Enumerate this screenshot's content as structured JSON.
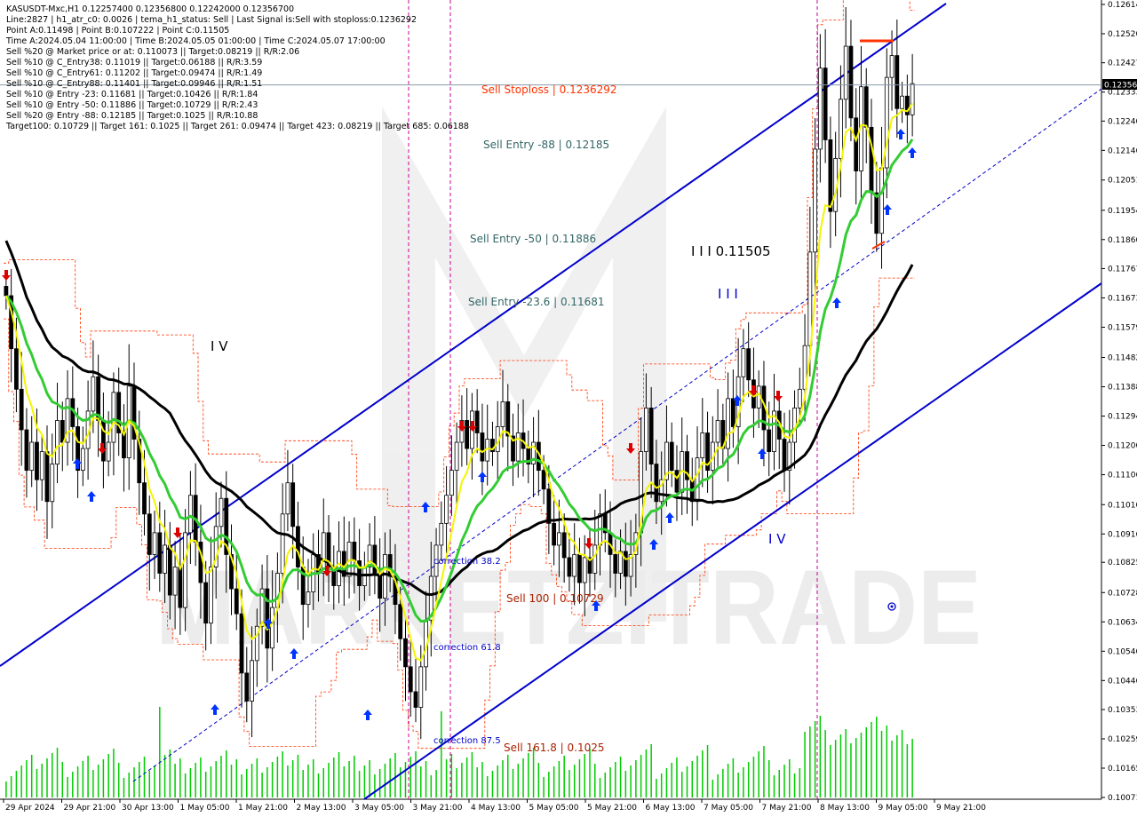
{
  "header": {
    "lines": [
      "KASUSDT-Mxc,H1  0.12257400 0.12356800 0.12242000 0.12356700",
      "Line:2827  |  h1_atr_c0: 0.0026  |  tema_h1_status: Sell  |  Last Signal is:Sell with stoploss:0.1236292",
      "Point A:0.11498  |  Point B:0.107222  |  Point C:0.11505",
      "Time A:2024.05.04 11:00:00  |  Time B:2024.05.05 01:00:00  |  Time C:2024.05.07 17:00:00",
      "Sell %20 @ Market price or at: 0.110073  ||  Target:0.08219  ||  R/R:2.06",
      "Sell %10 @ C_Entry38: 0.11019  ||  Target:0.06188  ||  R/R:3.59",
      "Sell %10 @ C_Entry61: 0.11202  ||  Target:0.09474  ||  R/R:1.49",
      "Sell %10 @ C_Entry88: 0.11401  ||  Target:0.09946  ||  R/R:1.51",
      "Sell %10 @ Entry -23: 0.11681  ||  Target:0.10426  ||  R/R:1.84",
      "Sell %10 @ Entry -50: 0.11886  ||  Target:0.10729  ||  R/R:2.43",
      "Sell %20 @ Entry -88: 0.12185  ||  Target:0.1025  ||  R/R:10.88",
      "Target100: 0.10729  ||  Target 161: 0.1025  ||  Target 261: 0.09474  ||  Target 423: 0.08219  ||  Target 685: 0.06188"
    ]
  },
  "annotations": {
    "sell_stoploss": "Sell Stoploss | 0.1236292",
    "sell_entry_88": "Sell Entry -88 | 0.12185",
    "sell_entry_50": "Sell Entry -50 | 0.11886",
    "sell_entry_23": "Sell Entry -23.6 | 0.11681",
    "wave_c_label": "I I I 0.11505",
    "wave_iii": "I I I",
    "wave_iv_left": "I V",
    "wave_iv_right": "I V",
    "correction_382": "correction 38.2",
    "correction_618": "correction 61.8",
    "correction_875": "correction 87.5",
    "sell_100": "Sell 100 | 0.10729",
    "sell_1618": "Sell 161.8 | 0.1025"
  },
  "current_price_label": "0.12356",
  "watermark": {
    "text": "MARKETZITRADE"
  },
  "colors": {
    "background": "#ffffff",
    "channel": "#0000cc",
    "ma_black": "#000000",
    "ma_green": "#33cc33",
    "ma_yellow": "#f5f500",
    "envelope": "#ff3300",
    "vline": "#cc0099",
    "stoploss": "#ff3300",
    "entry_text": "#336666",
    "price_line": "#8899aa",
    "sell_text": "#aa2200",
    "buy_arrow": "#0033ff",
    "sell_arrow": "#dd0000",
    "volume": "#00cc00"
  },
  "chart_data": {
    "type": "candlestick",
    "symbol": "KASUSDT-Mxc",
    "timeframe": "H1",
    "ohlc_last": {
      "open": 0.122574,
      "high": 0.123568,
      "low": 0.12242,
      "close": 0.123567
    },
    "ylim": [
      0.10071,
      0.12614
    ],
    "y_ticks": [
      0.12614,
      0.1252,
      0.12427,
      0.12333,
      0.1224,
      0.12146,
      0.12051,
      0.11954,
      0.1186,
      0.11767,
      0.11673,
      0.11579,
      0.11482,
      0.11388,
      0.11294,
      0.112,
      0.11106,
      0.1101,
      0.10916,
      0.10825,
      0.10728,
      0.10634,
      0.1054,
      0.10446,
      0.10353,
      0.10259,
      0.10165,
      0.10071
    ],
    "x_labels": [
      "29 Apr 2024",
      "29 Apr 21:00",
      "30 Apr 13:00",
      "1 May 05:00",
      "1 May 21:00",
      "2 May 13:00",
      "3 May 05:00",
      "3 May 21:00",
      "4 May 13:00",
      "5 May 05:00",
      "5 May 21:00",
      "6 May 13:00",
      "7 May 05:00",
      "7 May 21:00",
      "8 May 13:00",
      "9 May 05:00",
      "9 May 21:00"
    ],
    "levels": {
      "stoploss": 0.1236292,
      "current_price": 0.12356,
      "sell_entry_88": 0.12185,
      "sell_entry_50": 0.11886,
      "sell_entry_23": 0.11681,
      "sell_100": 0.10729,
      "sell_161": 0.1025,
      "point_a": 0.11498,
      "point_b": 0.107222,
      "point_c": 0.11505
    },
    "closes": [
      0.1168,
      0.1151,
      0.1138,
      0.1125,
      0.1112,
      0.1121,
      0.1109,
      0.1118,
      0.1102,
      0.1114,
      0.1128,
      0.1121,
      0.1135,
      0.1126,
      0.1112,
      0.1119,
      0.1131,
      0.1142,
      0.1128,
      0.1115,
      0.1121,
      0.1137,
      0.1124,
      0.1116,
      0.1139,
      0.1122,
      0.1108,
      0.1098,
      0.1085,
      0.1092,
      0.1079,
      0.1088,
      0.1072,
      0.1081,
      0.1068,
      0.1092,
      0.1104,
      0.1089,
      0.1076,
      0.1063,
      0.1081,
      0.1094,
      0.1103,
      0.1085,
      0.1074,
      0.1066,
      0.1047,
      0.1038,
      0.1051,
      0.1062,
      0.1074,
      0.1055,
      0.1068,
      0.1079,
      0.1098,
      0.1108,
      0.1094,
      0.1081,
      0.1069,
      0.1073,
      0.1085,
      0.1079,
      0.1092,
      0.1081,
      0.1075,
      0.1086,
      0.1078,
      0.1089,
      0.1083,
      0.1075,
      0.1081,
      0.1088,
      0.1079,
      0.1071,
      0.1085,
      0.1078,
      0.1069,
      0.1058,
      0.1049,
      0.1041,
      0.1036,
      0.1049,
      0.1064,
      0.1078,
      0.1088,
      0.1095,
      0.1104,
      0.1112,
      0.1121,
      0.1128,
      0.1119,
      0.1131,
      0.1124,
      0.1115,
      0.1122,
      0.1118,
      0.1126,
      0.1134,
      0.1123,
      0.1115,
      0.1124,
      0.1119,
      0.1114,
      0.1121,
      0.1112,
      0.1106,
      0.1095,
      0.1088,
      0.1092,
      0.1084,
      0.1078,
      0.1085,
      0.1076,
      0.1084,
      0.1079,
      0.1088,
      0.1098,
      0.1092,
      0.1085,
      0.1079,
      0.1086,
      0.1078,
      0.1085,
      0.1092,
      0.1118,
      0.1132,
      0.1114,
      0.1102,
      0.1109,
      0.1121,
      0.1112,
      0.1105,
      0.1118,
      0.1109,
      0.1102,
      0.1116,
      0.1124,
      0.1112,
      0.1121,
      0.1128,
      0.1119,
      0.1135,
      0.1126,
      0.1142,
      0.1151,
      0.1141,
      0.1132,
      0.1139,
      0.1125,
      0.1118,
      0.1131,
      0.1122,
      0.1112,
      0.1121,
      0.1132,
      0.1138,
      0.1152,
      0.1182,
      0.1215,
      0.1241,
      0.1218,
      0.1195,
      0.1212,
      0.1231,
      0.1248,
      0.1225,
      0.1208,
      0.1235,
      0.1222,
      0.1201,
      0.1188,
      0.1209,
      0.1238,
      0.1245,
      0.1228,
      0.1232,
      0.1226,
      0.1236
    ]
  }
}
